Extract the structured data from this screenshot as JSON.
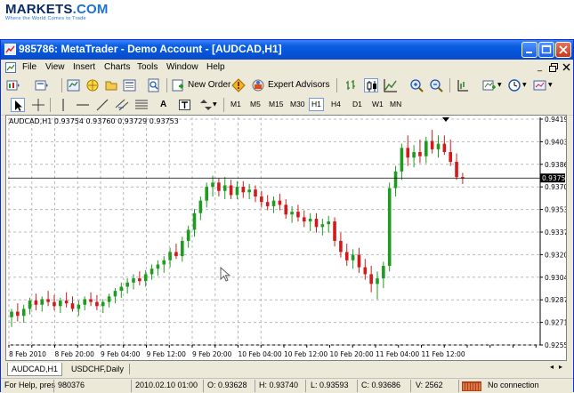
{
  "logo": {
    "main": "MARKETS",
    "suffix": ".COM",
    "tagline": "Where the World Comes to Trade"
  },
  "window": {
    "title": "985786: MetaTrader - Demo Account - [AUDCAD,H1]"
  },
  "menu": [
    "File",
    "View",
    "Insert",
    "Charts",
    "Tools",
    "Window",
    "Help"
  ],
  "toolbar": {
    "new_order": "New Order",
    "expert_advisors": "Expert Advisors"
  },
  "timeframes": [
    "M1",
    "M5",
    "M15",
    "M30",
    "H1",
    "H4",
    "D1",
    "W1",
    "MN"
  ],
  "active_timeframe": "H1",
  "chart": {
    "info": "AUDCAD,H1  0.93754 0.93760 0.93729 0.93753",
    "current_price": "0.93753",
    "price_labels": [
      "0.94190",
      "0.94030",
      "0.93865",
      "0.93700",
      "0.93535",
      "0.93370",
      "0.93205",
      "0.93040",
      "0.92875",
      "0.92710",
      "0.92550"
    ],
    "time_labels": [
      "8 Feb 2010",
      "8 Feb 20:00",
      "9 Feb 04:00",
      "9 Feb 12:00",
      "9 Feb 20:00",
      "10 Feb 04:00",
      "10 Feb 12:00",
      "10 Feb 20:00",
      "11 Feb 04:00",
      "11 Feb 12:00"
    ],
    "colors": {
      "bull": "#1f9c1f",
      "bear": "#d21a1a",
      "grid": "#b8b8b8"
    }
  },
  "chart_data": {
    "type": "candlestick",
    "symbol": "AUDCAD",
    "timeframe": "H1",
    "ylim": [
      0.9255,
      0.9419
    ],
    "candles": [
      [
        0.9275,
        0.9281,
        0.9268,
        0.9279
      ],
      [
        0.9279,
        0.9285,
        0.9272,
        0.9276
      ],
      [
        0.9276,
        0.9284,
        0.9271,
        0.9281
      ],
      [
        0.9281,
        0.9289,
        0.9277,
        0.9287
      ],
      [
        0.9287,
        0.9292,
        0.928,
        0.9284
      ],
      [
        0.9284,
        0.929,
        0.9279,
        0.9288
      ],
      [
        0.9288,
        0.9294,
        0.9283,
        0.9286
      ],
      [
        0.9286,
        0.9291,
        0.928,
        0.9283
      ],
      [
        0.9283,
        0.9289,
        0.9278,
        0.9287
      ],
      [
        0.9287,
        0.9293,
        0.9282,
        0.9285
      ],
      [
        0.9285,
        0.929,
        0.9279,
        0.9281
      ],
      [
        0.9281,
        0.9287,
        0.9276,
        0.9284
      ],
      [
        0.9284,
        0.929,
        0.928,
        0.9288
      ],
      [
        0.9288,
        0.9293,
        0.9283,
        0.9286
      ],
      [
        0.9286,
        0.9291,
        0.928,
        0.9283
      ],
      [
        0.9283,
        0.9288,
        0.9278,
        0.9286
      ],
      [
        0.9286,
        0.9292,
        0.9282,
        0.929
      ],
      [
        0.929,
        0.9296,
        0.9285,
        0.9294
      ],
      [
        0.9294,
        0.93,
        0.9289,
        0.9297
      ],
      [
        0.9297,
        0.9303,
        0.9292,
        0.93
      ],
      [
        0.93,
        0.9306,
        0.9295,
        0.9303
      ],
      [
        0.9303,
        0.9308,
        0.9298,
        0.9301
      ],
      [
        0.9301,
        0.9309,
        0.9297,
        0.9306
      ],
      [
        0.9306,
        0.9313,
        0.9302,
        0.931
      ],
      [
        0.931,
        0.9316,
        0.9305,
        0.9313
      ],
      [
        0.9313,
        0.9319,
        0.9307,
        0.9316
      ],
      [
        0.9316,
        0.9325,
        0.9311,
        0.9322
      ],
      [
        0.9322,
        0.9328,
        0.9317,
        0.9319
      ],
      [
        0.9319,
        0.9333,
        0.9315,
        0.933
      ],
      [
        0.933,
        0.9341,
        0.9325,
        0.9338
      ],
      [
        0.9338,
        0.9353,
        0.9333,
        0.935
      ],
      [
        0.935,
        0.9362,
        0.9345,
        0.9359
      ],
      [
        0.9359,
        0.9372,
        0.9354,
        0.9369
      ],
      [
        0.9369,
        0.9377,
        0.9362,
        0.9372
      ],
      [
        0.9372,
        0.9375,
        0.9362,
        0.9366
      ],
      [
        0.9366,
        0.9376,
        0.936,
        0.937
      ],
      [
        0.937,
        0.9374,
        0.936,
        0.9363
      ],
      [
        0.9363,
        0.9373,
        0.936,
        0.9369
      ],
      [
        0.9369,
        0.9373,
        0.9361,
        0.9365
      ],
      [
        0.9365,
        0.9371,
        0.936,
        0.9367
      ],
      [
        0.9367,
        0.937,
        0.9358,
        0.9362
      ],
      [
        0.9362,
        0.9366,
        0.9354,
        0.9358
      ],
      [
        0.9358,
        0.9363,
        0.9352,
        0.9355
      ],
      [
        0.9355,
        0.9362,
        0.935,
        0.9359
      ],
      [
        0.9359,
        0.9364,
        0.9352,
        0.9356
      ],
      [
        0.9356,
        0.936,
        0.9346,
        0.9349
      ],
      [
        0.9349,
        0.9355,
        0.9343,
        0.9351
      ],
      [
        0.9351,
        0.9356,
        0.9344,
        0.9347
      ],
      [
        0.9347,
        0.9352,
        0.934,
        0.9344
      ],
      [
        0.9344,
        0.935,
        0.9337,
        0.9346
      ],
      [
        0.9346,
        0.935,
        0.9336,
        0.934
      ],
      [
        0.934,
        0.9346,
        0.9334,
        0.9342
      ],
      [
        0.9342,
        0.9348,
        0.9336,
        0.9344
      ],
      [
        0.9344,
        0.9347,
        0.9326,
        0.933
      ],
      [
        0.933,
        0.9336,
        0.9318,
        0.9322
      ],
      [
        0.9322,
        0.9328,
        0.9312,
        0.9316
      ],
      [
        0.9316,
        0.9324,
        0.931,
        0.932
      ],
      [
        0.932,
        0.9325,
        0.9307,
        0.9311
      ],
      [
        0.9311,
        0.9317,
        0.9302,
        0.9306
      ],
      [
        0.9306,
        0.9312,
        0.9293,
        0.9299
      ],
      [
        0.9299,
        0.9308,
        0.9288,
        0.9303
      ],
      [
        0.9303,
        0.9315,
        0.9296,
        0.9312
      ],
      [
        0.9312,
        0.9372,
        0.9308,
        0.9368
      ],
      [
        0.9368,
        0.9384,
        0.9362,
        0.938
      ],
      [
        0.938,
        0.94,
        0.9374,
        0.9397
      ],
      [
        0.9397,
        0.9406,
        0.9384,
        0.939
      ],
      [
        0.939,
        0.9399,
        0.9383,
        0.9394
      ],
      [
        0.9394,
        0.9403,
        0.9386,
        0.9391
      ],
      [
        0.9391,
        0.9405,
        0.9386,
        0.9402
      ],
      [
        0.9402,
        0.941,
        0.9393,
        0.9396
      ],
      [
        0.9396,
        0.9406,
        0.939,
        0.94
      ],
      [
        0.94,
        0.9406,
        0.9392,
        0.9394
      ],
      [
        0.9394,
        0.9403,
        0.9384,
        0.9387
      ],
      [
        0.9387,
        0.9393,
        0.9374,
        0.9376
      ],
      [
        0.9376,
        0.9379,
        0.9371,
        0.9375
      ]
    ]
  },
  "chart_tabs": [
    "AUDCAD,H1",
    "USDCHF,Daily"
  ],
  "active_tab": "AUDCAD,H1",
  "status": {
    "help": "For Help, pres",
    "profile": "980376",
    "datetime": "2010.02.10 01:00",
    "open": "O: 0.93628",
    "high": "H: 0.93740",
    "low": "L: 0.93593",
    "close": "C: 0.93686",
    "volume": "V: 2562",
    "connection": "No connection"
  }
}
